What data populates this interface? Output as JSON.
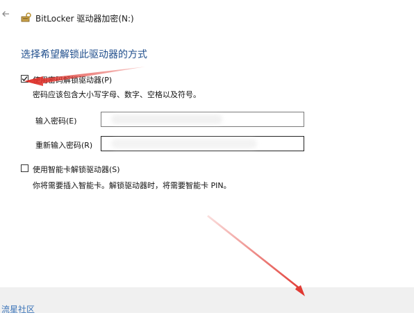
{
  "window": {
    "title": "BitLocker 驱动器加密(N:)"
  },
  "page": {
    "heading": "选择希望解锁此驱动器的方式"
  },
  "options": {
    "password": {
      "label": "使用密码解锁驱动器(P)",
      "checked": true,
      "hint": "密码应该包含大小写字母、数字、空格以及符号。",
      "enter_label": "输入密码(E)",
      "reenter_label": "重新输入密码(R)",
      "enter_value": "",
      "reenter_value": ""
    },
    "smartcard": {
      "label": "使用智能卡解锁驱动器(S)",
      "checked": false,
      "hint": "你将需要插入智能卡。解锁驱动器时，将需要智能卡 PIN。"
    }
  },
  "watermark": {
    "text": "流星社区"
  },
  "icons": {
    "back": "back-arrow-icon",
    "app": "bitlocker-key-icon",
    "check": "checkmark-icon"
  },
  "colors": {
    "heading": "#1f4e8c",
    "annotation_arrow": "#e0312a",
    "watermark": "#3a73b8"
  }
}
